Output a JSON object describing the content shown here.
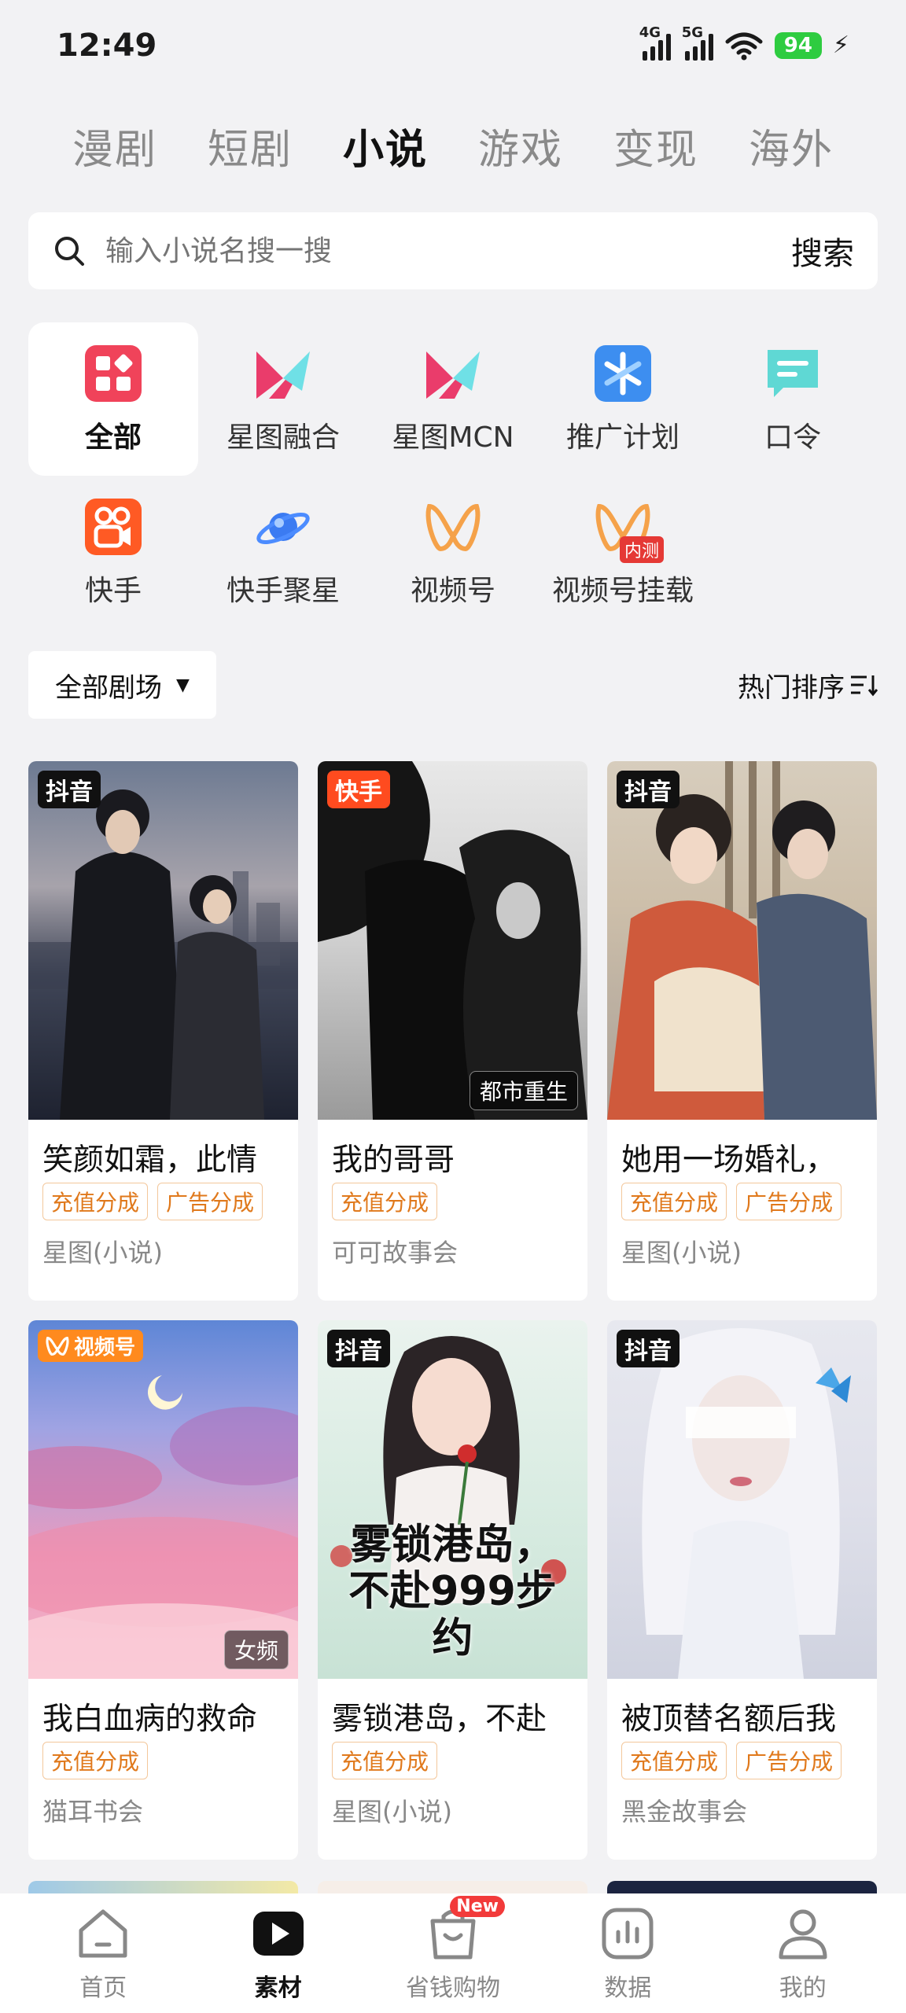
{
  "status": {
    "time": "12:49",
    "network_1": "4G",
    "network_2": "5G",
    "battery": "94"
  },
  "top_tabs": [
    {
      "label": "漫剧"
    },
    {
      "label": "短剧"
    },
    {
      "label": "小说"
    },
    {
      "label": "游戏"
    },
    {
      "label": "变现"
    },
    {
      "label": "海外"
    }
  ],
  "active_tab": "小说",
  "search": {
    "placeholder": "输入小说名搜一搜",
    "button": "搜索"
  },
  "categories": [
    {
      "label": "全部",
      "icon": "grid-icon"
    },
    {
      "label": "星图融合",
      "icon": "xingtu-icon"
    },
    {
      "label": "星图MCN",
      "icon": "xingtu-mcn-icon"
    },
    {
      "label": "推广计划",
      "icon": "promotion-icon"
    },
    {
      "label": "口令",
      "icon": "chat-icon"
    },
    {
      "label": "快手",
      "icon": "kuaishou-icon"
    },
    {
      "label": "快手聚星",
      "icon": "planet-icon"
    },
    {
      "label": "视频号",
      "icon": "channels-icon"
    },
    {
      "label": "视频号挂载",
      "icon": "channels-mount-icon",
      "badge": "内测"
    }
  ],
  "filter": {
    "theater": "全部剧场",
    "sort": "热门排序"
  },
  "cards": [
    {
      "platform": "抖音",
      "title": "笑颜如霜，此情",
      "chips": [
        "充值分成",
        "广告分成"
      ],
      "source": "星图(小说)",
      "genre": ""
    },
    {
      "platform": "快手",
      "title": "我的哥哥",
      "chips": [
        "充值分成"
      ],
      "source": "可可故事会",
      "genre": "都市重生"
    },
    {
      "platform": "抖音",
      "title": "她用一场婚礼，",
      "chips": [
        "充值分成",
        "广告分成"
      ],
      "source": "星图(小说)",
      "genre": ""
    },
    {
      "platform": "视频号",
      "title": "我白血病的救命",
      "chips": [
        "充值分成"
      ],
      "source": "猫耳书会",
      "genre": "女频"
    },
    {
      "platform": "抖音",
      "title": "雾锁港岛，不赴",
      "chips": [
        "充值分成"
      ],
      "source": "星图(小说)",
      "genre": "",
      "cover_text": "雾锁港岛，不赴999步约"
    },
    {
      "platform": "抖音",
      "title": "被顶替名额后我",
      "chips": [
        "充值分成",
        "广告分成"
      ],
      "source": "黑金故事会",
      "genre": ""
    }
  ],
  "bottom_nav": [
    {
      "label": "首页",
      "icon": "home-icon"
    },
    {
      "label": "素材",
      "icon": "play-icon"
    },
    {
      "label": "省钱购物",
      "icon": "shopping-bag-icon",
      "badge": "New"
    },
    {
      "label": "数据",
      "icon": "chart-icon"
    },
    {
      "label": "我的",
      "icon": "user-icon"
    }
  ],
  "colors": {
    "accent": "#111111",
    "chip": "#e0791c",
    "kuaishou": "#ff4b1f",
    "channels": "#ff8a1e",
    "douyin": "#111111"
  }
}
